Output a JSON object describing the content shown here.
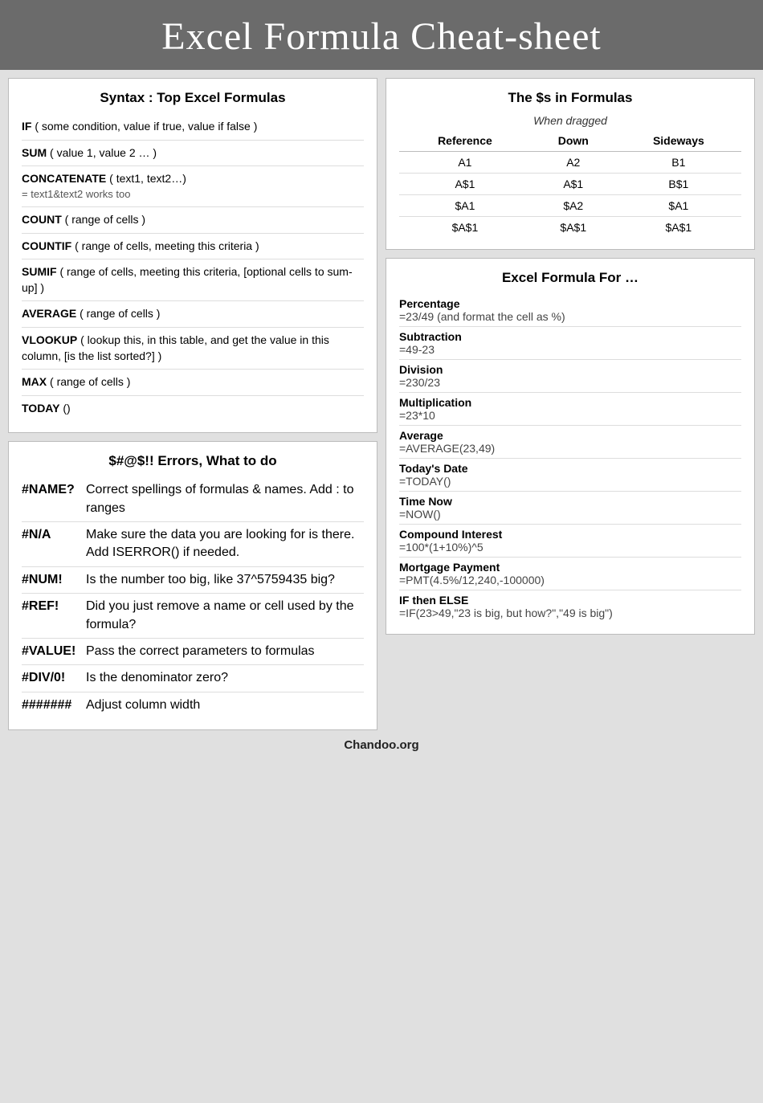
{
  "header": {
    "title": "Excel Formula Cheat-sheet"
  },
  "left": {
    "syntax_card": {
      "title": "Syntax : Top Excel Formulas",
      "formulas": [
        {
          "keyword": "IF",
          "desc": "( some condition, value if true, value if false )",
          "note": ""
        },
        {
          "keyword": "SUM",
          "desc": "( value 1, value 2 … )",
          "note": ""
        },
        {
          "keyword": "CONCATENATE",
          "desc": "( text1, text2…)",
          "note": "= text1&text2 works too"
        },
        {
          "keyword": "COUNT",
          "desc": "( range of cells )",
          "note": ""
        },
        {
          "keyword": "COUNTIF",
          "desc": "( range of cells, meeting this criteria )",
          "note": ""
        },
        {
          "keyword": "SUMIF",
          "desc": "( range of cells, meeting this criteria, [optional cells to sum-up] )",
          "note": ""
        },
        {
          "keyword": "AVERAGE",
          "desc": "( range of cells )",
          "note": ""
        },
        {
          "keyword": "VLOOKUP",
          "desc": "( lookup this, in this table, and get the value in this column, [is the list sorted?] )",
          "note": ""
        },
        {
          "keyword": "MAX",
          "desc": "( range of cells )",
          "note": ""
        },
        {
          "keyword": "TODAY",
          "desc": "()",
          "note": ""
        }
      ]
    },
    "errors_card": {
      "title": "$#@$!! Errors, What to do",
      "errors": [
        {
          "code": "#NAME?",
          "desc": "Correct spellings of formulas & names. Add : to ranges"
        },
        {
          "code": "#N/A",
          "desc": "Make sure the data you are looking for is there. Add ISERROR() if needed."
        },
        {
          "code": "#NUM!",
          "desc": "Is the number too big, like 37^5759435 big?"
        },
        {
          "code": "#REF!",
          "desc": "Did you just remove a name or cell used by the formula?"
        },
        {
          "code": "#VALUE!",
          "desc": "Pass the correct parameters to formulas"
        },
        {
          "code": "#DIV/0!",
          "desc": "Is the denominator zero?"
        },
        {
          "code": "#######",
          "desc": "Adjust column width"
        }
      ]
    }
  },
  "right": {
    "dollar_card": {
      "title": "The $s in Formulas",
      "when_dragged": "When dragged",
      "headers": [
        "Reference",
        "Down",
        "Sideways"
      ],
      "rows": [
        [
          "A1",
          "A2",
          "B1"
        ],
        [
          "A$1",
          "A$1",
          "B$1"
        ],
        [
          "$A1",
          "$A2",
          "$A1"
        ],
        [
          "$A$1",
          "$A$1",
          "$A$1"
        ]
      ]
    },
    "formulas_card": {
      "title": "Excel Formula For …",
      "items": [
        {
          "label": "Percentage",
          "value": "=23/49 (and format the cell as %)"
        },
        {
          "label": "Subtraction",
          "value": "=49-23"
        },
        {
          "label": "Division",
          "value": "=230/23"
        },
        {
          "label": "Multiplication",
          "value": "=23*10"
        },
        {
          "label": "Average",
          "value": "=AVERAGE(23,49)"
        },
        {
          "label": "Today's Date",
          "value": "=TODAY()"
        },
        {
          "label": "Time Now",
          "value": "=NOW()"
        },
        {
          "label": "Compound Interest",
          "value": "=100*(1+10%)^5"
        },
        {
          "label": "Mortgage Payment",
          "value": "=PMT(4.5%/12,240,-100000)"
        },
        {
          "label": "IF then ELSE",
          "value": "=IF(23>49,\"23 is big, but how?\",\"49 is big\")"
        }
      ]
    }
  },
  "footer": {
    "text": "Chandoo.org"
  }
}
